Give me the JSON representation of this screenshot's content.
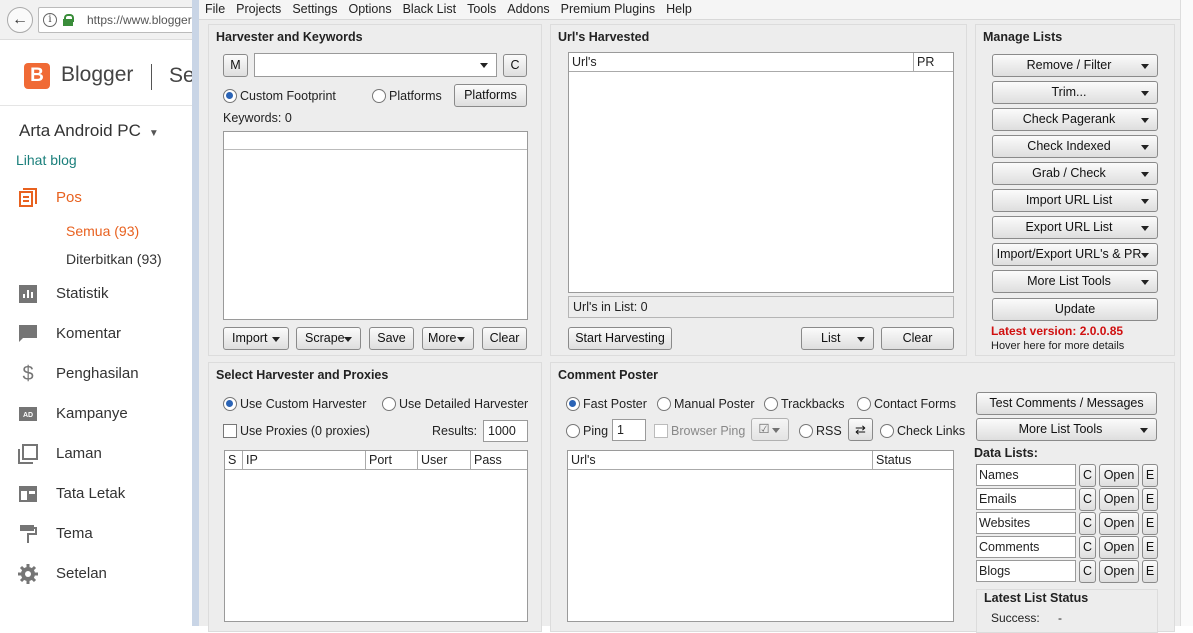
{
  "browser": {
    "url": "https://www.blogger.com"
  },
  "blogger": {
    "brand": "Blogger",
    "brand_sub": "Se",
    "blog_title": "Arta Android PC",
    "view_blog": "Lihat blog",
    "nav": [
      {
        "label": "Pos",
        "icon": "posts-icon",
        "active": true
      },
      {
        "label": "Statistik",
        "icon": "stats-icon"
      },
      {
        "label": "Komentar",
        "icon": "comment-icon"
      },
      {
        "label": "Penghasilan",
        "icon": "dollar-icon"
      },
      {
        "label": "Kampanye",
        "icon": "ads-icon"
      },
      {
        "label": "Laman",
        "icon": "pages-icon"
      },
      {
        "label": "Tata Letak",
        "icon": "layout-icon"
      },
      {
        "label": "Tema",
        "icon": "theme-icon"
      },
      {
        "label": "Setelan",
        "icon": "gear-icon"
      }
    ],
    "sub": {
      "all": "Semua (93)",
      "published": "Diterbitkan (93)"
    }
  },
  "app": {
    "menu": [
      "File",
      "Projects",
      "Settings",
      "Options",
      "Black List",
      "Tools",
      "Addons",
      "Premium Plugins",
      "Help"
    ],
    "harvester": {
      "title": "Harvester and Keywords",
      "m_btn": "M",
      "c_btn": "C",
      "custom_footprint": "Custom Footprint",
      "platforms_radio": "Platforms",
      "platforms_btn": "Platforms",
      "keywords": "Keywords:  0",
      "import": "Import",
      "scrape": "Scrape",
      "save": "Save",
      "more": "More",
      "clear": "Clear"
    },
    "urls": {
      "title": "Url's Harvested",
      "col_url": "Url's",
      "col_pr": "PR",
      "in_list": "Url's in List: 0",
      "start": "Start Harvesting",
      "list": "List",
      "clear": "Clear"
    },
    "manage": {
      "title": "Manage Lists",
      "buttons": [
        "Remove / Filter",
        "Trim...",
        "Check Pagerank",
        "Check Indexed",
        "Grab / Check",
        "Import URL List",
        "Export URL List",
        "Import/Export URL's & PR",
        "More List Tools"
      ],
      "update": "Update",
      "latest": "Latest version:  2.0.0.85",
      "hover": "Hover here for more details"
    },
    "proxies": {
      "title": "Select Harvester and Proxies",
      "custom": "Use Custom Harvester",
      "detailed": "Use Detailed Harvester",
      "use_proxies": "Use Proxies  (0 proxies)",
      "results_label": "Results:",
      "results_value": "1000",
      "cols": [
        "S",
        "IP",
        "Port",
        "User",
        "Pass"
      ]
    },
    "poster": {
      "title": "Comment Poster",
      "fast": "Fast Poster",
      "manual": "Manual Poster",
      "trackbacks": "Trackbacks",
      "contact": "Contact Forms",
      "ping": "Ping",
      "ping_value": "1",
      "browser_ping": "Browser Ping",
      "rss": "RSS",
      "check_links": "Check Links",
      "test_btn": "Test Comments / Messages",
      "more_tools": "More List Tools",
      "col_url": "Url's",
      "col_status": "Status",
      "data_lists": "Data Lists:",
      "lists": [
        "Names",
        "Emails",
        "Websites",
        "Comments",
        "Blogs"
      ],
      "c": "C",
      "open": "Open",
      "e": "E",
      "latest_status": "Latest List Status",
      "success": "Success:",
      "success_value": "-"
    }
  }
}
